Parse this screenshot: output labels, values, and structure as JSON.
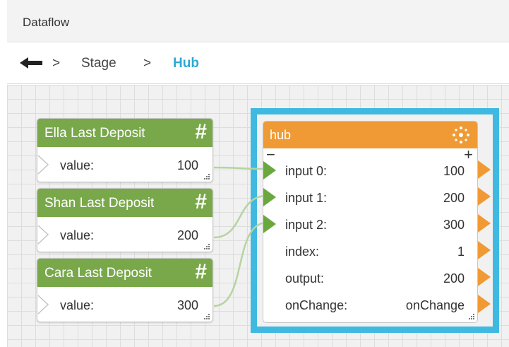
{
  "window": {
    "title": "Dataflow"
  },
  "breadcrumb": {
    "separator": ">",
    "items": [
      {
        "label": "Stage"
      },
      {
        "label": "Hub"
      }
    ]
  },
  "value_nodes": [
    {
      "title": "Ella Last Deposit",
      "label": "value:",
      "value": "100"
    },
    {
      "title": "Shan Last Deposit",
      "label": "value:",
      "value": "200"
    },
    {
      "title": "Cara Last Deposit",
      "label": "value:",
      "value": "300"
    }
  ],
  "hub_node": {
    "title": "hub",
    "remove_symbol": "−",
    "add_symbol": "+",
    "rows": [
      {
        "label": "input 0:",
        "value": "100"
      },
      {
        "label": "input 1:",
        "value": "200"
      },
      {
        "label": "input 2:",
        "value": "300"
      },
      {
        "label": "index:",
        "value": "1"
      },
      {
        "label": "output:",
        "value": "200"
      },
      {
        "label": "onChange:",
        "value": "onChange"
      }
    ]
  },
  "icons": {
    "back": "back-arrow-icon",
    "hash": "hash-icon",
    "hub": "hub-icon",
    "input_port": "input-port-icon",
    "output_port": "output-port-icon",
    "resize": "resize-grip-icon"
  },
  "colors": {
    "value_node_header": "#79a84a",
    "hub_header": "#f09a35",
    "selection_frame": "#3fb9e0",
    "breadcrumb_active": "#2fa9d6",
    "input_port": "#6aa83e",
    "output_port": "#f09a35",
    "wire": "#b7d3a0"
  }
}
